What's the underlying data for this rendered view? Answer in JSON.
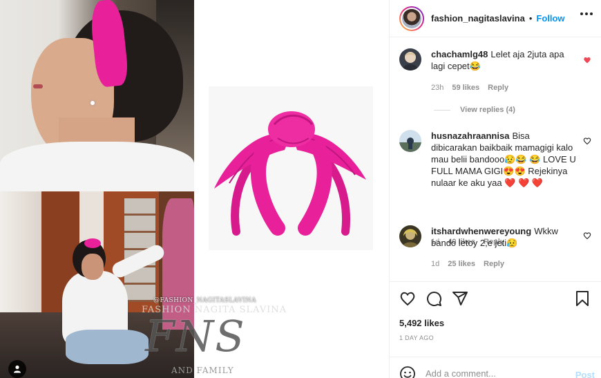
{
  "post": {
    "author": "fashion_nagitaslavina",
    "follow_label": "Follow",
    "separator": "•",
    "watermark_handle": "@FASHION_NAGITASLAVINA",
    "watermark_name": "FASHION NAGITA SLAVINA",
    "watermark_logo": "FNS",
    "watermark_family": "AND FAMILY",
    "likes": "5,492 likes",
    "date": "1 DAY AGO"
  },
  "comments": [
    {
      "user": "chachamlg48",
      "text": "Lelet aja 2juta apa lagi cepet😂",
      "time": "23h",
      "likes": "59 likes",
      "reply": "Reply",
      "liked": true,
      "view_replies": "View replies (4)"
    },
    {
      "user": "husnazahraannisa",
      "text": "Bisa dibicarakan baikbaik mamagigi kalo mau belii bandooo😥😂 😂 LOVE U FULL MAMA GIGI😍😍 Rejekinya nulaar ke aku yaa ❤️ ❤️ ❤️",
      "time": "1d",
      "likes": "40 likes",
      "reply": "Reply",
      "liked": false
    },
    {
      "user": "itshardwhenwereyoung",
      "text": "Wkkw bando letoy 2,e jeti😥",
      "time": "1d",
      "likes": "25 likes",
      "reply": "Reply",
      "liked": false
    }
  ],
  "composer": {
    "placeholder": "Add a comment...",
    "post_label": "Post"
  },
  "icons": {
    "like": "heart-icon",
    "comment": "comment-icon",
    "share": "share-icon",
    "save": "bookmark-icon",
    "more": "more-icon",
    "emoji": "emoji-icon",
    "tag": "user-tag-icon"
  },
  "colors": {
    "accent": "#0095f6",
    "like_red": "#ed4956",
    "headband_pink": "#e8219a",
    "post_disabled": "#b2dffc"
  }
}
